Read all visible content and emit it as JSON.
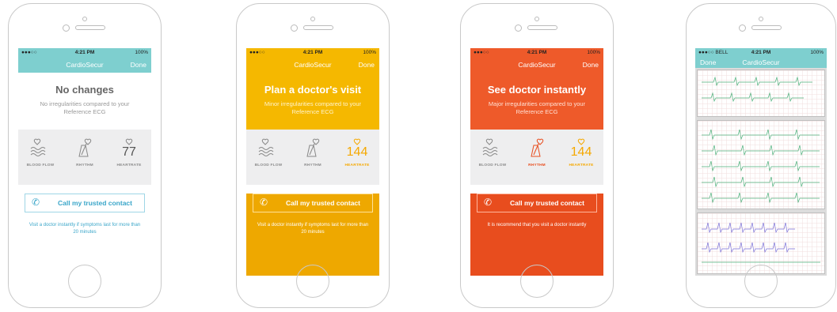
{
  "phones": [
    {
      "status": {
        "signal": "●●●○○",
        "time": "4:21 PM",
        "battery": "100%"
      },
      "nav": {
        "title": "CardioSecur",
        "done": "Done"
      },
      "hero": {
        "title": "No changes",
        "subtitle": "No irregularities compared to your Reference ECG"
      },
      "metrics": {
        "blood_flow": "BLOOD FLOW",
        "rhythm": "RHYTHM",
        "heartrate_label": "HEARTRATE",
        "heartrate_value": "77"
      },
      "call_label": "Call my trusted contact",
      "note": "Visit a doctor instantly if symptoms last for more than 20 minutes"
    },
    {
      "status": {
        "signal": "●●●○○",
        "time": "4:21 PM",
        "battery": "100%"
      },
      "nav": {
        "title": "CardioSecur",
        "done": "Done"
      },
      "hero": {
        "title": "Plan a doctor's visit",
        "subtitle": "Minor irregularities compared to your Reference ECG"
      },
      "metrics": {
        "blood_flow": "BLOOD FLOW",
        "rhythm": "RHYTHM",
        "heartrate_label": "HEARTRATE",
        "heartrate_value": "144"
      },
      "call_label": "Call my trusted contact",
      "note": "Visit a doctor instantly if symptoms last for more than 20 minutes"
    },
    {
      "status": {
        "signal": "●●●○○",
        "time": "4:21 PM",
        "battery": "100%"
      },
      "nav": {
        "title": "CardioSecur",
        "done": "Done"
      },
      "hero": {
        "title": "See doctor instantly",
        "subtitle": "Major irregularities compared to your Reference ECG"
      },
      "metrics": {
        "blood_flow": "BLOOD FLOW",
        "rhythm": "RHYTHM",
        "heartrate_label": "HEARTRATE",
        "heartrate_value": "144"
      },
      "call_label": "Call my trusted contact",
      "note": "It is recommend that you visit a doctor instantly"
    },
    {
      "status": {
        "signal": "●●●○○ BELL",
        "time": "4:21 PM",
        "battery": "100%"
      },
      "nav": {
        "title": "CardioSecur",
        "done": "Done"
      }
    }
  ],
  "colors": {
    "teal": "#7ecfcf",
    "yellow": "#f5b800",
    "yellow_dark": "#eea800",
    "orange": "#ee5a2a",
    "orange_dark": "#e84d1e",
    "gray_text": "#777777",
    "blue_text": "#3aa6c9"
  },
  "icons": [
    "heart-icon",
    "wave-icon",
    "metronome-icon",
    "phone-icon"
  ]
}
